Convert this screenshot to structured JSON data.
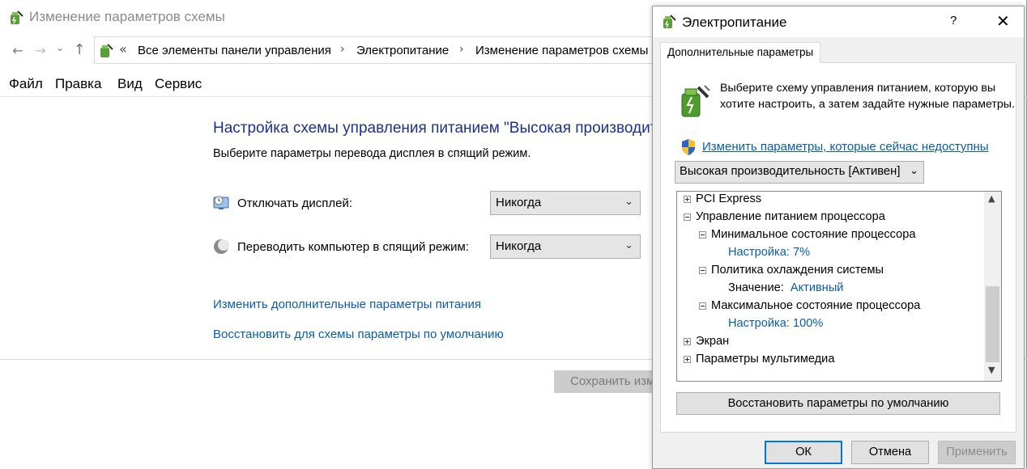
{
  "bg_window": {
    "title": "Изменение параметров схемы",
    "nav": {
      "back": "←",
      "forward": "→",
      "dropdown": "⌄",
      "up": "↑"
    },
    "address": {
      "lead": "«",
      "crumbs": [
        "Все элементы панели управления",
        "Электропитание",
        "Изменение параметров схемы"
      ],
      "sep": "›"
    },
    "menu": [
      "Файл",
      "Правка",
      "Вид",
      "Сервис"
    ],
    "heading": "Настройка схемы управления питанием \"Высокая производительность\"",
    "subheading": "Выберите параметры перевода дисплея в спящий режим.",
    "display_off": {
      "label": "Отключать дисплей:",
      "value": "Никогда"
    },
    "sleep": {
      "label": "Переводить компьютер в спящий режим:",
      "value": "Никогда"
    },
    "links": {
      "advanced": "Изменить дополнительные параметры питания",
      "restore_defaults": "Восстановить для схемы параметры по умолчанию"
    },
    "save_button": "Сохранить изменения"
  },
  "dialog": {
    "title": "Электропитание",
    "help": "?",
    "close": "✕",
    "tab": "Дополнительные параметры",
    "intro": "Выберите схему управления питанием, которую вы хотите настроить, а затем задайте нужные параметры.",
    "unavailable_link": "Изменить параметры, которые сейчас недоступны",
    "scheme_select": "Высокая производительность [Активен]",
    "tree": {
      "pci": "PCI Express",
      "cpu": "Управление питанием процессора",
      "min_state": "Минимальное состояние процессора",
      "setting_label": "Настройка:",
      "min_value": "7%",
      "cooling": "Политика охлаждения системы",
      "value_label": "Значение:",
      "cooling_value": "Активный",
      "max_state": "Максимальное состояние процессора",
      "max_value": "100%",
      "screen": "Экран",
      "multimedia": "Параметры мультимедиа"
    },
    "restore_button": "Восстановить параметры по умолчанию",
    "ok": "ОК",
    "cancel": "Отмена",
    "apply": "Применить"
  },
  "colors": {
    "link": "#0b5dab",
    "heading": "#1e3287",
    "ok_border": "#0078d7"
  }
}
